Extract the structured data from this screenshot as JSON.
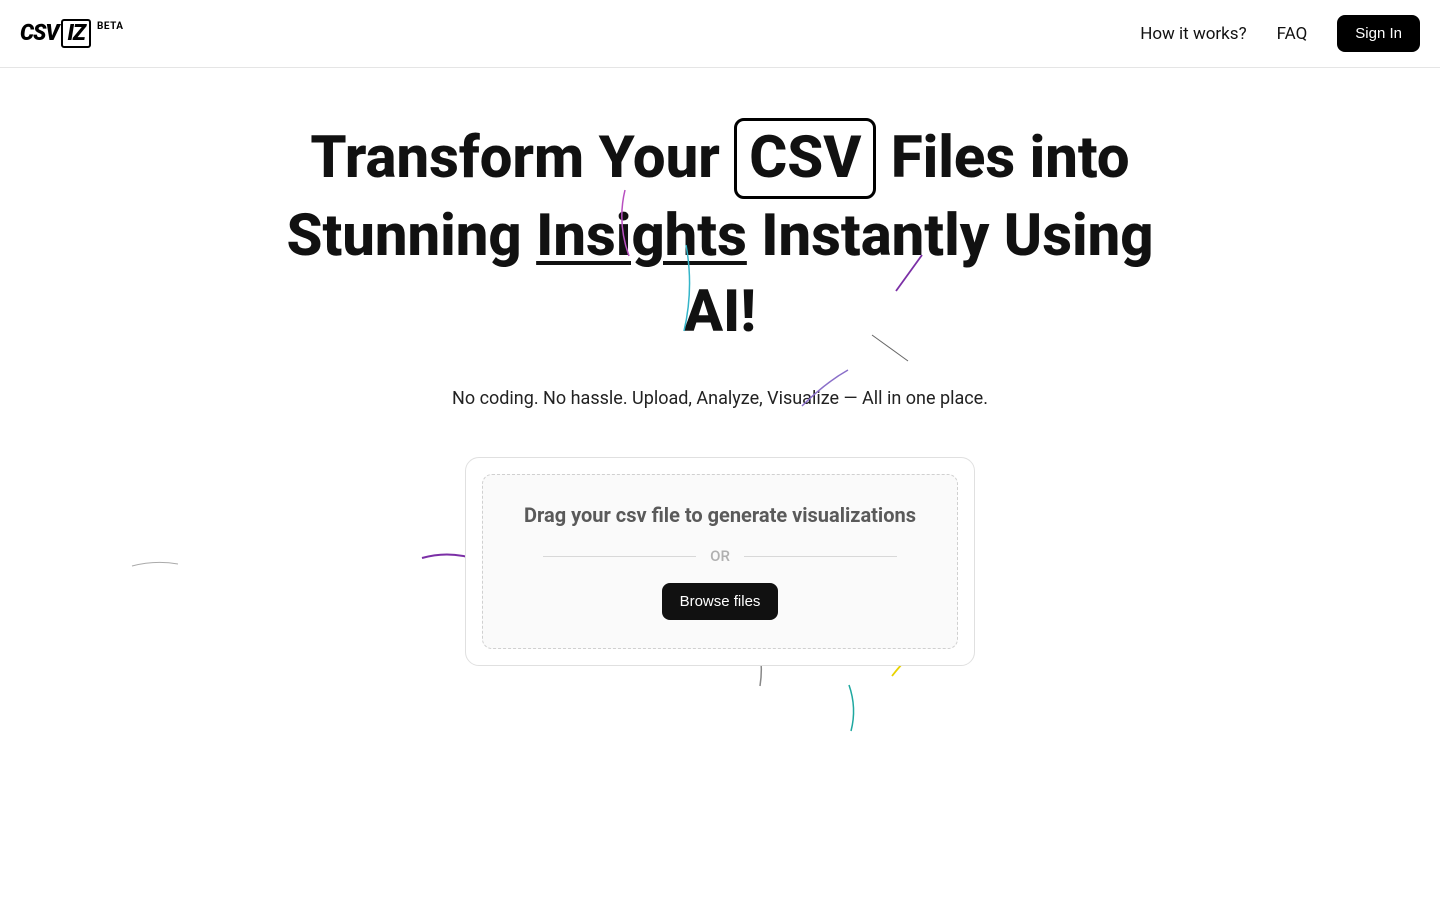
{
  "header": {
    "logo": {
      "part1": "CSV",
      "part2": "IZ",
      "badge": "BETA"
    },
    "nav": {
      "how_it_works": "How it works?",
      "faq": "FAQ",
      "sign_in": "Sign In"
    }
  },
  "hero": {
    "title_pre": "Transform Your ",
    "title_csv": "CSV",
    "title_mid": " Files into Stunning ",
    "title_insights": "Insights",
    "title_post": " Instantly Using AI!",
    "subtitle": "No coding. No hassle. Upload, Analyze, Visualize — All in one place."
  },
  "upload": {
    "drag_text": "Drag your csv file to generate visualizations",
    "or": "OR",
    "browse": "Browse files"
  }
}
